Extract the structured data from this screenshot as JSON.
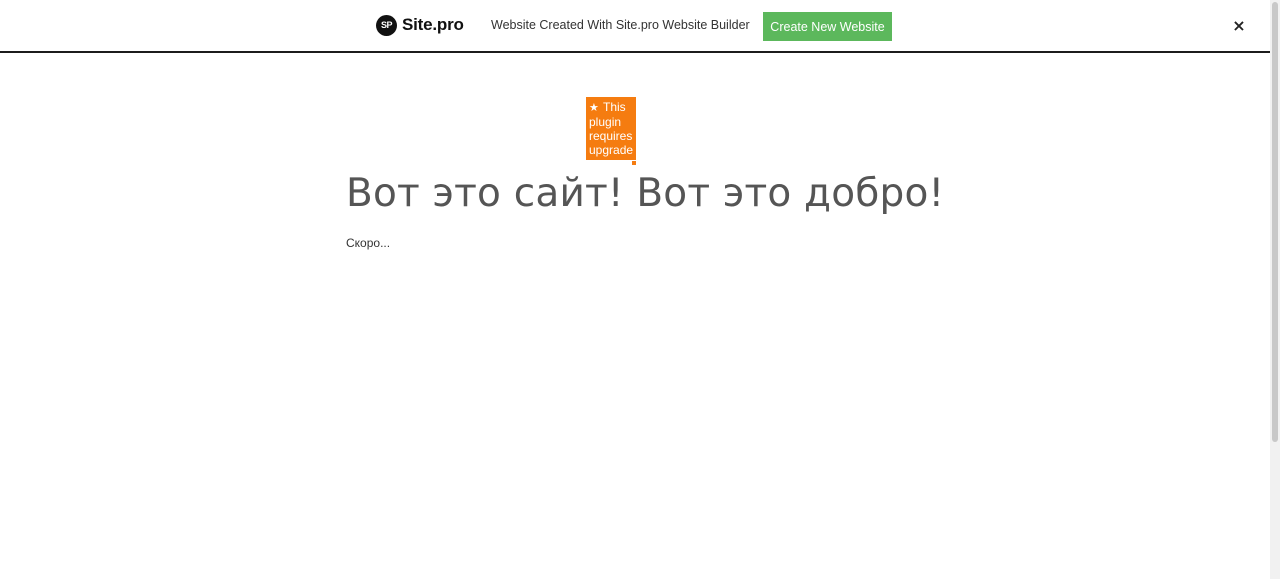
{
  "topbar": {
    "brand_logo": "SP",
    "brand_name": "Site.pro",
    "promo_text": "Website Created With Site.pro Website Builder",
    "create_button_label": "Create New Website",
    "close_glyph": "×",
    "button_color": "#5cb85c"
  },
  "plugin_badge": {
    "star_icon": "★",
    "text": "This plugin requires upgrade",
    "color": "#f57c10"
  },
  "main": {
    "title": "Вот это сайт! Вот это добро!",
    "text": "Скоро..."
  }
}
